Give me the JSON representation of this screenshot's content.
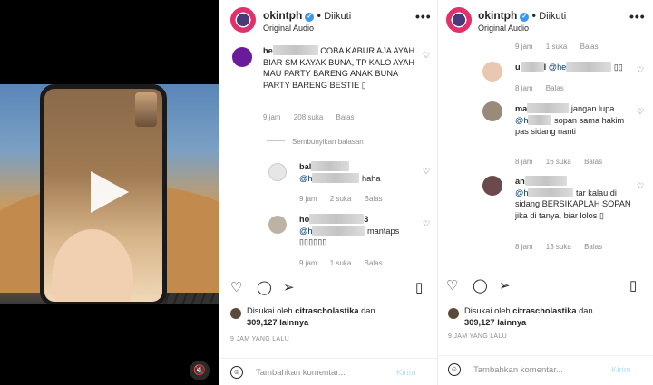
{
  "account": {
    "username": "okintph",
    "follow_status": "Diikuti",
    "audio": "Original Audio"
  },
  "panel1": {
    "top_comment": {
      "user_prefix": "he",
      "text": "COBA KABUR AJA AYAH BIAR SM KAYAK BUNA, TP KALO AYAH MAU PARTY BARENG ANAK BUNA PARTY BARENG BESTIE",
      "emoji": "▯",
      "time": "9 jam",
      "likes": "208 suka",
      "reply": "Balas"
    },
    "hide_replies": "Sembunyikan balasan",
    "replies": [
      {
        "user_prefix": "bal",
        "mention_prefix": "@h",
        "text": "haha",
        "time": "9 jam",
        "likes": "2 suka",
        "reply": "Balas"
      },
      {
        "user_prefix": "ho",
        "user_suffix": "3",
        "mention_prefix": "@h",
        "text": "mantaps",
        "emoji": "▯▯▯▯▯▯",
        "time": "9 jam",
        "likes": "1 suka",
        "reply": "Balas"
      }
    ]
  },
  "panel2": {
    "top_meta": {
      "time": "9 jam",
      "likes": "1 suka",
      "reply": "Balas"
    },
    "comments": [
      {
        "user_prefix": "u",
        "user_suffix": "l",
        "mention_prefix": "@he",
        "emoji": "▯▯",
        "time": "8 jam",
        "reply": "Balas"
      },
      {
        "user_prefix": "ma",
        "mention_prefix": "@h",
        "text_a": "jangan lupa",
        "text_b": "sopan sama hakim pas sidang nanti",
        "time": "8 jam",
        "likes": "16 suka",
        "reply": "Balas"
      },
      {
        "user_prefix": "an",
        "mention_prefix": "@h",
        "text_a": "tar kalau di",
        "text_b": "sidang BERSIKAPLAH SOPAN jika di tanya, biar lolos",
        "emoji": "▯",
        "time": "8 jam",
        "likes": "13 suka",
        "reply": "Balas"
      }
    ]
  },
  "likes_prefix": "Disukai oleh",
  "likes_user": "citrascholastika",
  "likes_and": "dan",
  "likes_count": "309,127 lainnya",
  "posted_time": "9 JAM YANG LALU",
  "composer": {
    "placeholder": "Tambahkan komentar...",
    "send": "Kirim"
  },
  "icons": [
    "heart-icon",
    "comment-icon",
    "share-icon",
    "bookmark-icon",
    "more-icon",
    "mute-icon",
    "play-icon",
    "emoji-icon",
    "verified-icon"
  ],
  "colors": {
    "verified": "#3897f0",
    "mention": "#00376b",
    "muted": "#8e8e8e",
    "send": "#b2dffc"
  }
}
